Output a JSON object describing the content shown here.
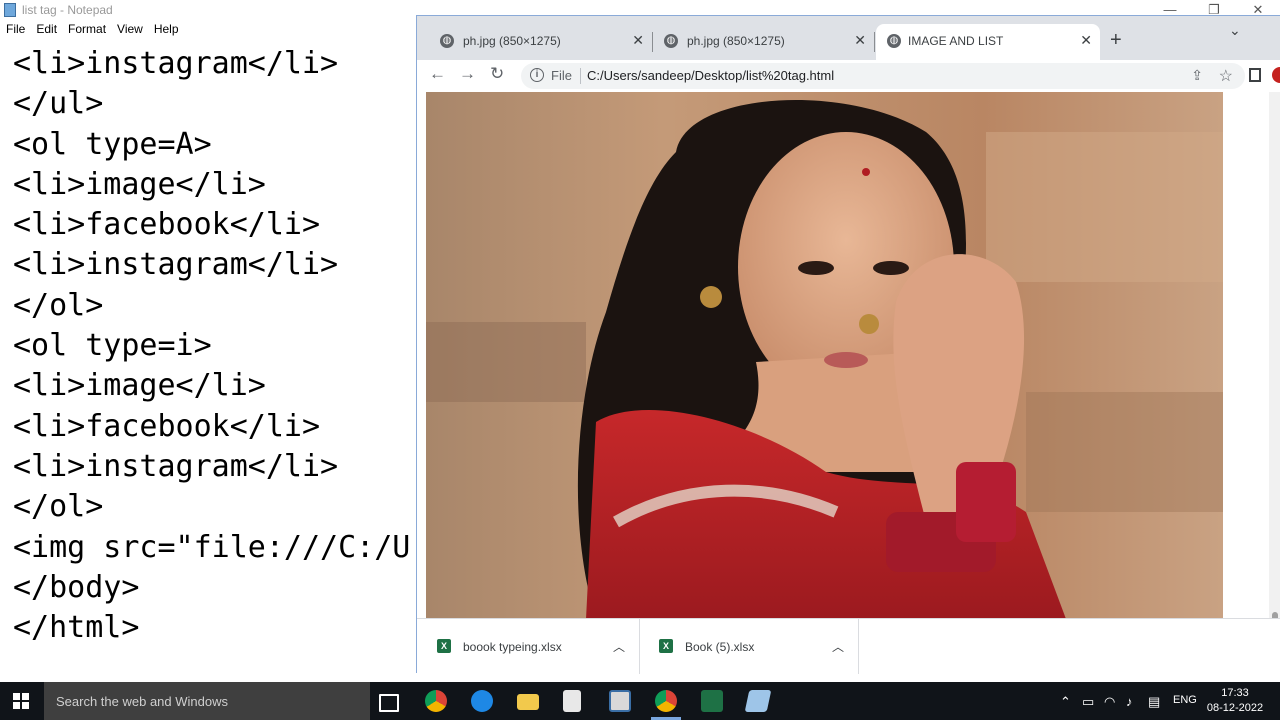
{
  "notepad": {
    "title": "list tag - Notepad",
    "menu": [
      "File",
      "Edit",
      "Format",
      "View",
      "Help"
    ],
    "code": "<li>instagram</li>\n</ul>\n<ol type=A>\n<li>image</li>\n<li>facebook</li>\n<li>instagram</li>\n</ol>\n<ol type=i>\n<li>image</li>\n<li>facebook</li>\n<li>instagram</li>\n</ol>\n<img src=\"file:///C:/U\n</body>\n</html>"
  },
  "chrome": {
    "tabs": [
      {
        "label": "ph.jpg (850×1275)",
        "active": false
      },
      {
        "label": "ph.jpg (850×1275)",
        "active": false
      },
      {
        "label": "IMAGE AND LIST",
        "active": true
      }
    ],
    "address": {
      "scheme": "File",
      "url": "C:/Users/sandeep/Desktop/list%20tag.html"
    },
    "downloads": [
      {
        "name": "boook typeing.xlsx"
      },
      {
        "name": "Book (5).xlsx"
      }
    ]
  },
  "taskbar": {
    "search_placeholder": "Search the web and Windows",
    "language": "ENG",
    "time": "17:33",
    "date": "08-12-2022"
  },
  "colors": {
    "taskbar_bg": "#101419",
    "tabstrip_bg": "#dee1e6",
    "chrome_border": "#8aaad8"
  }
}
